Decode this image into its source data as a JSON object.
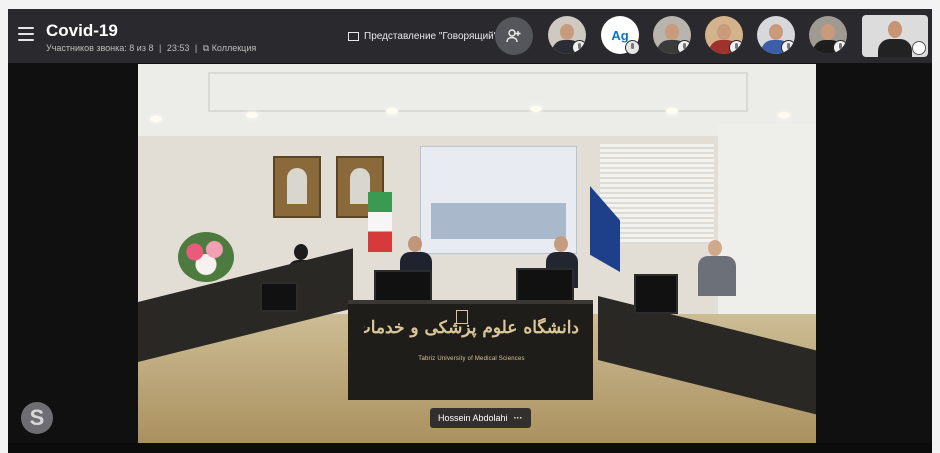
{
  "header": {
    "title": "Covid-19",
    "participants": "Участников звонка: 8 из 8",
    "duration": "23:53",
    "separator": "|",
    "collection": "Коллекция",
    "view_mode": "Представление \"Говорящий\"",
    "view_chevron": "▾"
  },
  "participants_bar": {
    "initials_avatar": "Ag"
  },
  "stage": {
    "speaker_name": "Hossein Abdolahi",
    "more": "···",
    "sign_persian": "دانشگاه علوم پزشکی و خدمات بهداشتی درمانی تبریز",
    "sign_english": "Tabriz University of Medical Sciences"
  },
  "brand": {
    "logo_letter": "S"
  },
  "colors": {
    "topbar": "#2a2a2e",
    "accent": "#0b71c7",
    "background": "#101010"
  }
}
